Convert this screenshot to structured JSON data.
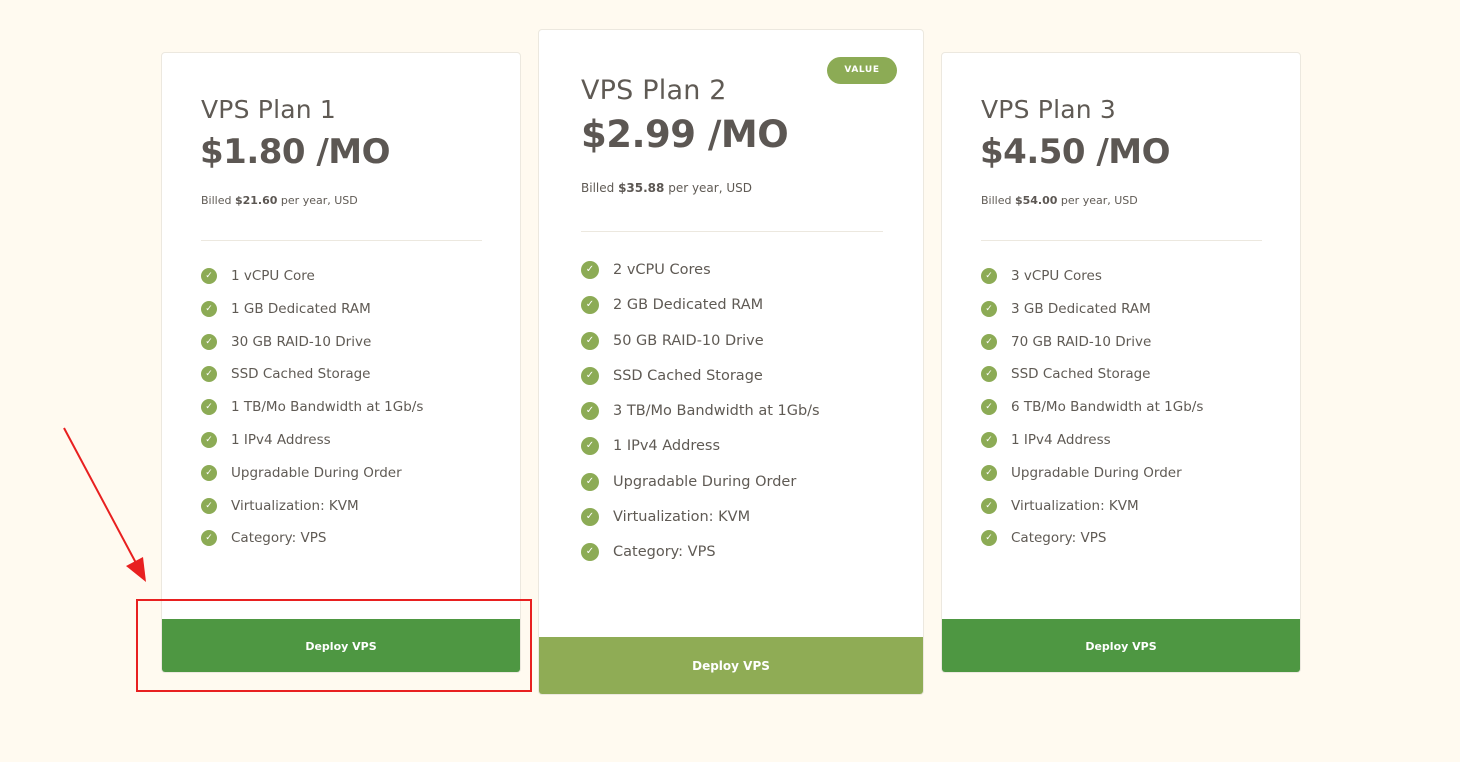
{
  "colors": {
    "background": "#fffaf0",
    "card": "#ffffff",
    "accent_green": "#8cab55",
    "deploy_green": "#4e9742",
    "deploy_olive": "#8fac55",
    "annotation_red": "#e82020"
  },
  "plans": [
    {
      "name": "VPS Plan 1",
      "price": "$1.80 /MO",
      "billed_prefix": "Billed",
      "billed_amount": "$21.60",
      "billed_suffix": "per year, USD",
      "features": [
        "1 vCPU Core",
        "1 GB Dedicated RAM",
        "30 GB RAID-10 Drive",
        "SSD Cached Storage",
        "1 TB/Mo Bandwidth at 1Gb/s",
        "1 IPv4 Address",
        "Upgradable During Order",
        "Virtualization: KVM",
        "Category: VPS"
      ],
      "button_label": "Deploy VPS"
    },
    {
      "name": "VPS Plan 2",
      "badge": "VALUE",
      "price": "$2.99 /MO",
      "billed_prefix": "Billed",
      "billed_amount": "$35.88",
      "billed_suffix": "per year, USD",
      "features": [
        "2 vCPU Cores",
        "2 GB Dedicated RAM",
        "50 GB RAID-10 Drive",
        "SSD Cached Storage",
        "3 TB/Mo Bandwidth at 1Gb/s",
        "1 IPv4 Address",
        "Upgradable During Order",
        "Virtualization: KVM",
        "Category: VPS"
      ],
      "button_label": "Deploy VPS"
    },
    {
      "name": "VPS Plan 3",
      "price": "$4.50 /MO",
      "billed_prefix": "Billed",
      "billed_amount": "$54.00",
      "billed_suffix": "per year, USD",
      "features": [
        "3 vCPU Cores",
        "3 GB Dedicated RAM",
        "70 GB RAID-10 Drive",
        "SSD Cached Storage",
        "6 TB/Mo Bandwidth at 1Gb/s",
        "1 IPv4 Address",
        "Upgradable During Order",
        "Virtualization: KVM",
        "Category: VPS"
      ],
      "button_label": "Deploy VPS"
    }
  ],
  "icons": {
    "feature_check": "check-circle-icon",
    "annotation_arrow": "arrow-icon"
  }
}
